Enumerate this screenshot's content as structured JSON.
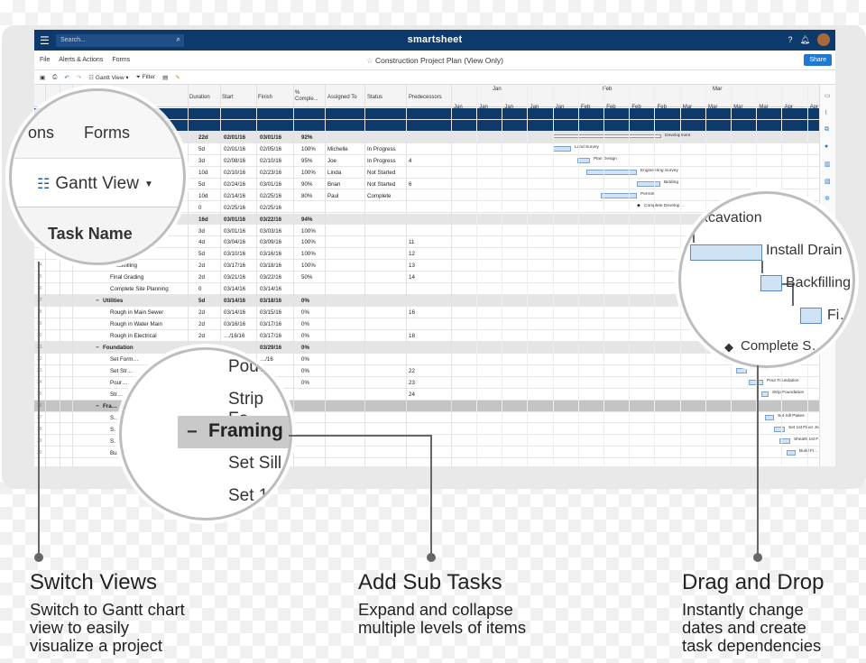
{
  "app": {
    "search_placeholder": "Search...",
    "brand": "smartsheet",
    "menus": [
      "File",
      "Alerts & Actions",
      "Forms"
    ],
    "doc_title": "Construction Project Plan (View Only)",
    "share_label": "Share",
    "toolbar": {
      "view_label": "Gantt View ▾",
      "filter_label": "Filter"
    }
  },
  "columns": [
    "Duration",
    "Start",
    "Finish",
    "% Comple...",
    "Assigned To",
    "Status",
    "Predecessors"
  ],
  "timeline": {
    "months": [
      "Jan",
      "Feb",
      "Mar"
    ],
    "weeks": [
      "Jan 3",
      "Jan 10",
      "Jan 17",
      "Jan 24",
      "Jan 31",
      "Feb 7",
      "Feb 14",
      "Feb 21",
      "Feb 28",
      "Mar 6",
      "Mar 13",
      "Mar 20",
      "Mar 27",
      "Apr 3",
      "Apr"
    ]
  },
  "rows": [
    {
      "num": "",
      "name": "",
      "dur": "",
      "start": "",
      "finish": "",
      "pct": "",
      "who": "",
      "status": "",
      "pred": "",
      "type": "band"
    },
    {
      "num": "",
      "name": "",
      "dur": "",
      "start": "",
      "finish": "",
      "pct": "",
      "who": "",
      "status": "",
      "pred": "",
      "type": "band"
    },
    {
      "num": "",
      "name": "",
      "dur": "22d",
      "start": "02/01/16",
      "finish": "03/01/16",
      "pct": "92%",
      "who": "",
      "status": "",
      "pred": "",
      "type": "parent"
    },
    {
      "num": "",
      "name": "",
      "dur": "5d",
      "start": "02/01/16",
      "finish": "02/05/16",
      "pct": "100%",
      "who": "Michelle",
      "status": "In Progress",
      "pred": "",
      "type": "child"
    },
    {
      "num": "",
      "name": "",
      "dur": "3d",
      "start": "02/08/16",
      "finish": "02/10/16",
      "pct": "95%",
      "who": "Joe",
      "status": "In Progress",
      "pred": "4",
      "type": "child"
    },
    {
      "num": "",
      "name": "",
      "dur": "10d",
      "start": "02/10/16",
      "finish": "02/23/16",
      "pct": "100%",
      "who": "Linda",
      "status": "Not Started",
      "pred": "",
      "type": "child"
    },
    {
      "num": "",
      "name": "",
      "dur": "5d",
      "start": "02/24/16",
      "finish": "03/01/16",
      "pct": "90%",
      "who": "Brian",
      "status": "Not Started",
      "pred": "6",
      "type": "child"
    },
    {
      "num": "",
      "name": "",
      "dur": "10d",
      "start": "02/14/16",
      "finish": "02/25/16",
      "pct": "80%",
      "who": "Paul",
      "status": "Complete",
      "pred": "",
      "type": "child"
    },
    {
      "num": "",
      "name": "",
      "dur": "0",
      "start": "02/25/16",
      "finish": "02/25/16",
      "pct": "",
      "who": "",
      "status": "",
      "pred": "",
      "type": "child"
    },
    {
      "num": "",
      "name": "",
      "dur": "16d",
      "start": "03/01/16",
      "finish": "03/22/16",
      "pct": "94%",
      "who": "",
      "status": "",
      "pred": "",
      "type": "parent"
    },
    {
      "num": "",
      "name": "",
      "dur": "3d",
      "start": "03/01/16",
      "finish": "03/03/16",
      "pct": "100%",
      "who": "",
      "status": "",
      "pred": "",
      "type": "child"
    },
    {
      "num": "",
      "name": "",
      "dur": "4d",
      "start": "03/04/16",
      "finish": "03/09/16",
      "pct": "100%",
      "who": "",
      "status": "",
      "pred": "11",
      "type": "child"
    },
    {
      "num": "",
      "name": "…ile",
      "dur": "5d",
      "start": "03/10/16",
      "finish": "03/16/16",
      "pct": "100%",
      "who": "",
      "status": "",
      "pred": "12",
      "type": "child"
    },
    {
      "num": "14",
      "name": "…ackfilling",
      "dur": "2d",
      "start": "03/17/16",
      "finish": "03/18/16",
      "pct": "100%",
      "who": "",
      "status": "",
      "pred": "13",
      "type": "child"
    },
    {
      "num": "15",
      "name": "Final Grading",
      "dur": "2d",
      "start": "03/21/16",
      "finish": "03/22/16",
      "pct": "50%",
      "who": "",
      "status": "",
      "pred": "14",
      "type": "child"
    },
    {
      "num": "16",
      "name": "Complete Site Planning",
      "dur": "0",
      "start": "03/14/16",
      "finish": "03/14/16",
      "pct": "",
      "who": "",
      "status": "",
      "pred": "",
      "type": "child"
    },
    {
      "num": "17",
      "name": "Utilities",
      "dur": "5d",
      "start": "03/14/16",
      "finish": "03/18/16",
      "pct": "0%",
      "who": "",
      "status": "",
      "pred": "",
      "type": "parent"
    },
    {
      "num": "18",
      "name": "Rough in Main Sewer",
      "dur": "2d",
      "start": "03/14/16",
      "finish": "03/15/16",
      "pct": "0%",
      "who": "",
      "status": "",
      "pred": "16",
      "type": "child"
    },
    {
      "num": "19",
      "name": "Rough in Water Main",
      "dur": "2d",
      "start": "03/16/16",
      "finish": "03/17/16",
      "pct": "0%",
      "who": "",
      "status": "",
      "pred": "",
      "type": "child"
    },
    {
      "num": "20",
      "name": "Rough in Electrical",
      "dur": "2d",
      "start": "…/16/16",
      "finish": "03/17/16",
      "pct": "0%",
      "who": "",
      "status": "",
      "pred": "18",
      "type": "child"
    },
    {
      "num": "21",
      "name": "Foundation",
      "dur": "",
      "start": "",
      "finish": "03/29/16",
      "pct": "0%",
      "who": "",
      "status": "",
      "pred": "",
      "type": "parent"
    },
    {
      "num": "22",
      "name": "Set Form…",
      "dur": "",
      "start": "",
      "finish": "…/16",
      "pct": "0%",
      "who": "",
      "status": "",
      "pred": "",
      "type": "child"
    },
    {
      "num": "23",
      "name": "Set Str…",
      "dur": "",
      "start": "",
      "finish": "",
      "pct": "0%",
      "who": "",
      "status": "",
      "pred": "22",
      "type": "child"
    },
    {
      "num": "24",
      "name": "Pour…",
      "dur": "",
      "start": "",
      "finish": "",
      "pct": "0%",
      "who": "",
      "status": "",
      "pred": "23",
      "type": "child"
    },
    {
      "num": "25",
      "name": "Str…",
      "dur": "",
      "start": "",
      "finish": "",
      "pct": "",
      "who": "",
      "status": "",
      "pred": "24",
      "type": "child"
    },
    {
      "num": "26",
      "name": "Fra…",
      "dur": "",
      "start": "",
      "finish": "",
      "pct": "",
      "who": "",
      "status": "",
      "pred": "",
      "type": "parent2"
    },
    {
      "num": "27",
      "name": "S…",
      "dur": "",
      "start": "",
      "finish": "",
      "pct": "",
      "who": "",
      "status": "",
      "pred": "",
      "type": "child"
    },
    {
      "num": "28",
      "name": "S…",
      "dur": "",
      "start": "",
      "finish": "",
      "pct": "",
      "who": "",
      "status": "",
      "pred": "",
      "type": "child"
    },
    {
      "num": "29",
      "name": "S…",
      "dur": "",
      "start": "",
      "finish": "",
      "pct": "",
      "who": "",
      "status": "",
      "pred": "",
      "type": "child"
    },
    {
      "num": "30",
      "name": "Bu…",
      "dur": "",
      "start": "",
      "finish": "",
      "pct": "",
      "who": "",
      "status": "",
      "pred": "",
      "type": "child"
    }
  ],
  "gantt_labels": [
    "Development",
    "Land Survey",
    "Plan Design",
    "Engineering Survey",
    "Bidding",
    "Permits",
    "Complete Develop…",
    "Set Form",
    "Set Steel",
    "Pour Foundation",
    "Strip Foundation",
    "Set Sill Plates",
    "Set 1st Floor Jois…",
    "Sheath 1st F…",
    "Build Fi…"
  ],
  "lens_left": {
    "forms_partial": "ons",
    "forms": "Forms",
    "view": "Gantt View",
    "task_name": "Task Name"
  },
  "lens_mid": {
    "l1": "Pou…",
    "l2": "Strip Fo…",
    "l3": "Framing",
    "l4": "Set Sill…",
    "l5": "Set 1…"
  },
  "lens_right": {
    "l1": "xcavation",
    "l2": "Install Drain",
    "l3": "Backfilling",
    "l4": "Fi…",
    "l5": "Complete S…"
  },
  "callouts": [
    {
      "title": "Switch Views",
      "body": [
        "Switch to Gantt chart",
        "view to easily",
        "visualize a project"
      ]
    },
    {
      "title": "Add Sub Tasks",
      "body": [
        "Expand and collapse",
        "multiple levels of items"
      ]
    },
    {
      "title": "Drag and Drop",
      "body": [
        "Instantly change",
        "dates and create",
        "task dependencies"
      ]
    }
  ]
}
